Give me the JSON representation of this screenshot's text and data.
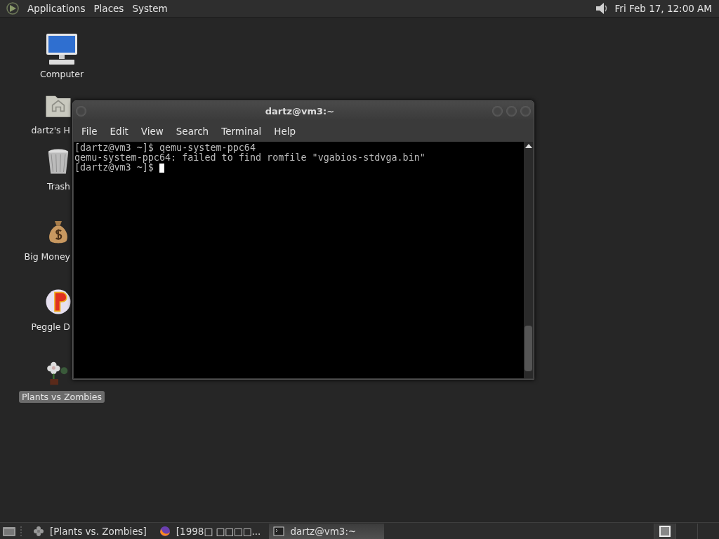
{
  "top_panel": {
    "menus": [
      {
        "label": "Applications"
      },
      {
        "label": "Places"
      },
      {
        "label": "System"
      }
    ],
    "clock": "Fri Feb 17, 12:00 AM"
  },
  "desktop_icons": [
    {
      "label": "Computer",
      "kind": "computer",
      "selected": false
    },
    {
      "label": "dartz's H",
      "kind": "home",
      "selected": false
    },
    {
      "label": "Trash",
      "kind": "trash",
      "selected": false
    },
    {
      "label": "Big Money",
      "kind": "money",
      "selected": false
    },
    {
      "label": "Peggle D",
      "kind": "peggle",
      "selected": false
    },
    {
      "label": "Plants vs Zombies",
      "kind": "flower",
      "selected": true
    }
  ],
  "window": {
    "title": "dartz@vm3:~",
    "menus": [
      "File",
      "Edit",
      "View",
      "Search",
      "Terminal",
      "Help"
    ],
    "lines": [
      "[dartz@vm3 ~]$ qemu-system-ppc64",
      "qemu-system-ppc64: failed to find romfile \"vgabios-stdvga.bin\"",
      "[dartz@vm3 ~]$"
    ]
  },
  "taskbar": [
    {
      "label": "[Plants vs. Zombies]",
      "kind": "flower",
      "selected": false
    },
    {
      "label": "[1998□ □□□□...",
      "kind": "browser",
      "selected": false
    },
    {
      "label": "dartz@vm3:~",
      "kind": "terminal",
      "selected": true
    }
  ],
  "workspaces": [
    {
      "selected": true
    },
    {
      "selected": false
    },
    {
      "selected": false
    }
  ]
}
